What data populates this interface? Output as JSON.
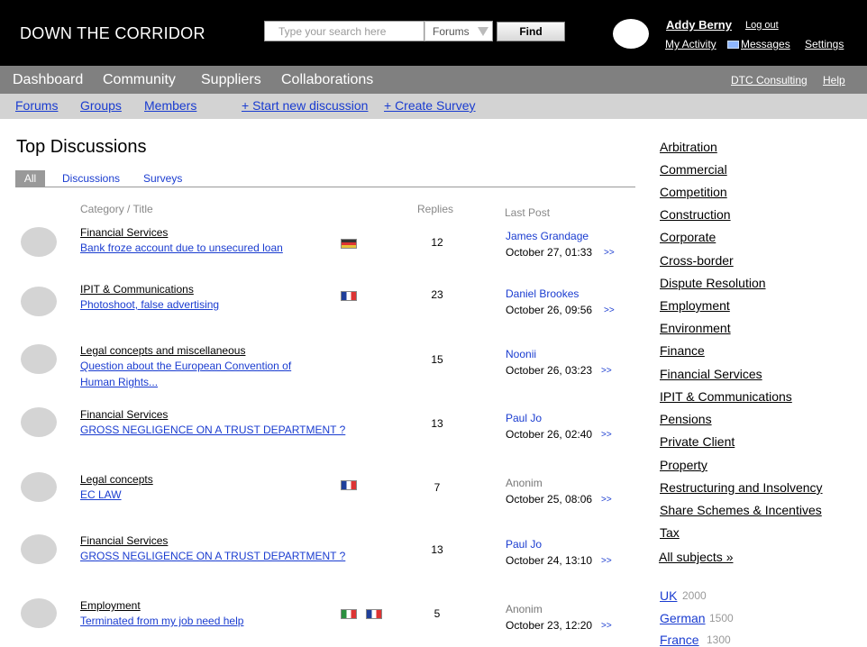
{
  "header": {
    "site_title": "DOWN THE CORRIDOR",
    "search_placeholder": "Type your search here",
    "search_scope": "Forums",
    "find_label": "Find",
    "user_name": "Addy Berny",
    "logout_label": "Log out",
    "my_activity_label": "My Activity",
    "messages_label": "Messages",
    "settings_label": "Settings",
    "messages_icon": "envelope-icon"
  },
  "main_nav": {
    "items": [
      {
        "label": "Dashboard"
      },
      {
        "label": "Community"
      },
      {
        "label": "Suppliers"
      },
      {
        "label": "Collaborations"
      }
    ],
    "right": [
      {
        "label": "DTC Consulting"
      },
      {
        "label": "Help"
      }
    ]
  },
  "sub_nav": {
    "items": [
      {
        "label": "Forums"
      },
      {
        "label": "Groups"
      },
      {
        "label": "Members"
      },
      {
        "label": "+ Start new discussion"
      },
      {
        "label": "+ Create Survey"
      }
    ]
  },
  "discussions": {
    "title": "Top Discussions",
    "tabs": [
      {
        "label": "All",
        "active": true
      },
      {
        "label": "Discussions"
      },
      {
        "label": "Surveys"
      }
    ],
    "columns": {
      "title": "Category / Title",
      "replies": "Replies",
      "last_post": "Last Post"
    },
    "more_label": ">>",
    "rows": [
      {
        "category": "Financial Services",
        "title_lines": [
          "Bank froze account due to unsecured loan"
        ],
        "flags": [
          "de"
        ],
        "replies": "12",
        "author": "James Grandage",
        "date": "October 27, 01:33"
      },
      {
        "category": "IPIT & Communications",
        "title_lines": [
          "Photoshoot, false advertising"
        ],
        "flags": [
          "fr"
        ],
        "replies": "23",
        "author": "Daniel Brookes",
        "date": "October 26, 09:56"
      },
      {
        "category": "Legal concepts and miscellaneous",
        "title_lines": [
          "Question about the European Convention of ",
          "Human Rights..."
        ],
        "flags": [],
        "replies": "15",
        "author": "Noonii",
        "date": "October 26, 03:23"
      },
      {
        "category": "Financial Services",
        "title_lines": [
          "GROSS NEGLIGENCE ON A TRUST DEPARTMENT ?"
        ],
        "flags": [],
        "replies": "13",
        "author": "Paul Jo",
        "date": "October 26, 02:40"
      },
      {
        "category": "Legal concepts",
        "title_lines": [
          "EC LAW"
        ],
        "flags": [
          "fr"
        ],
        "replies": "7",
        "author": "Anonim",
        "anonymous": true,
        "date": "October 25, 08:06"
      },
      {
        "category": "Financial Services",
        "title_lines": [
          "GROSS NEGLIGENCE ON A TRUST DEPARTMENT ?"
        ],
        "flags": [],
        "replies": "13",
        "author": "Paul Jo",
        "date": "October 24, 13:10"
      },
      {
        "category": "Employment",
        "title_lines": [
          "Terminated from my job need help"
        ],
        "flags": [
          "it",
          "fr"
        ],
        "replies": "5",
        "author": "Anonim",
        "anonymous": true,
        "date": "October 23, 12:20"
      }
    ]
  },
  "subjects": {
    "items": [
      "Arbitration",
      "Commercial",
      "Competition",
      "Construction",
      "Corporate",
      "Cross-border",
      "Dispute Resolution",
      "Employment",
      "Environment",
      "Finance",
      "Financial Services ",
      "IPIT & Communications",
      "Pensions",
      "Private Client ",
      "Property",
      "Restructuring and Insolvency",
      "Share Schemes & Incentives ",
      "Tax"
    ],
    "all_label": "All subjects »"
  },
  "countries": [
    {
      "name": "UK",
      "count": "2000"
    },
    {
      "name": "German",
      "count": "1500"
    },
    {
      "name": "France",
      "count": "1300"
    }
  ]
}
